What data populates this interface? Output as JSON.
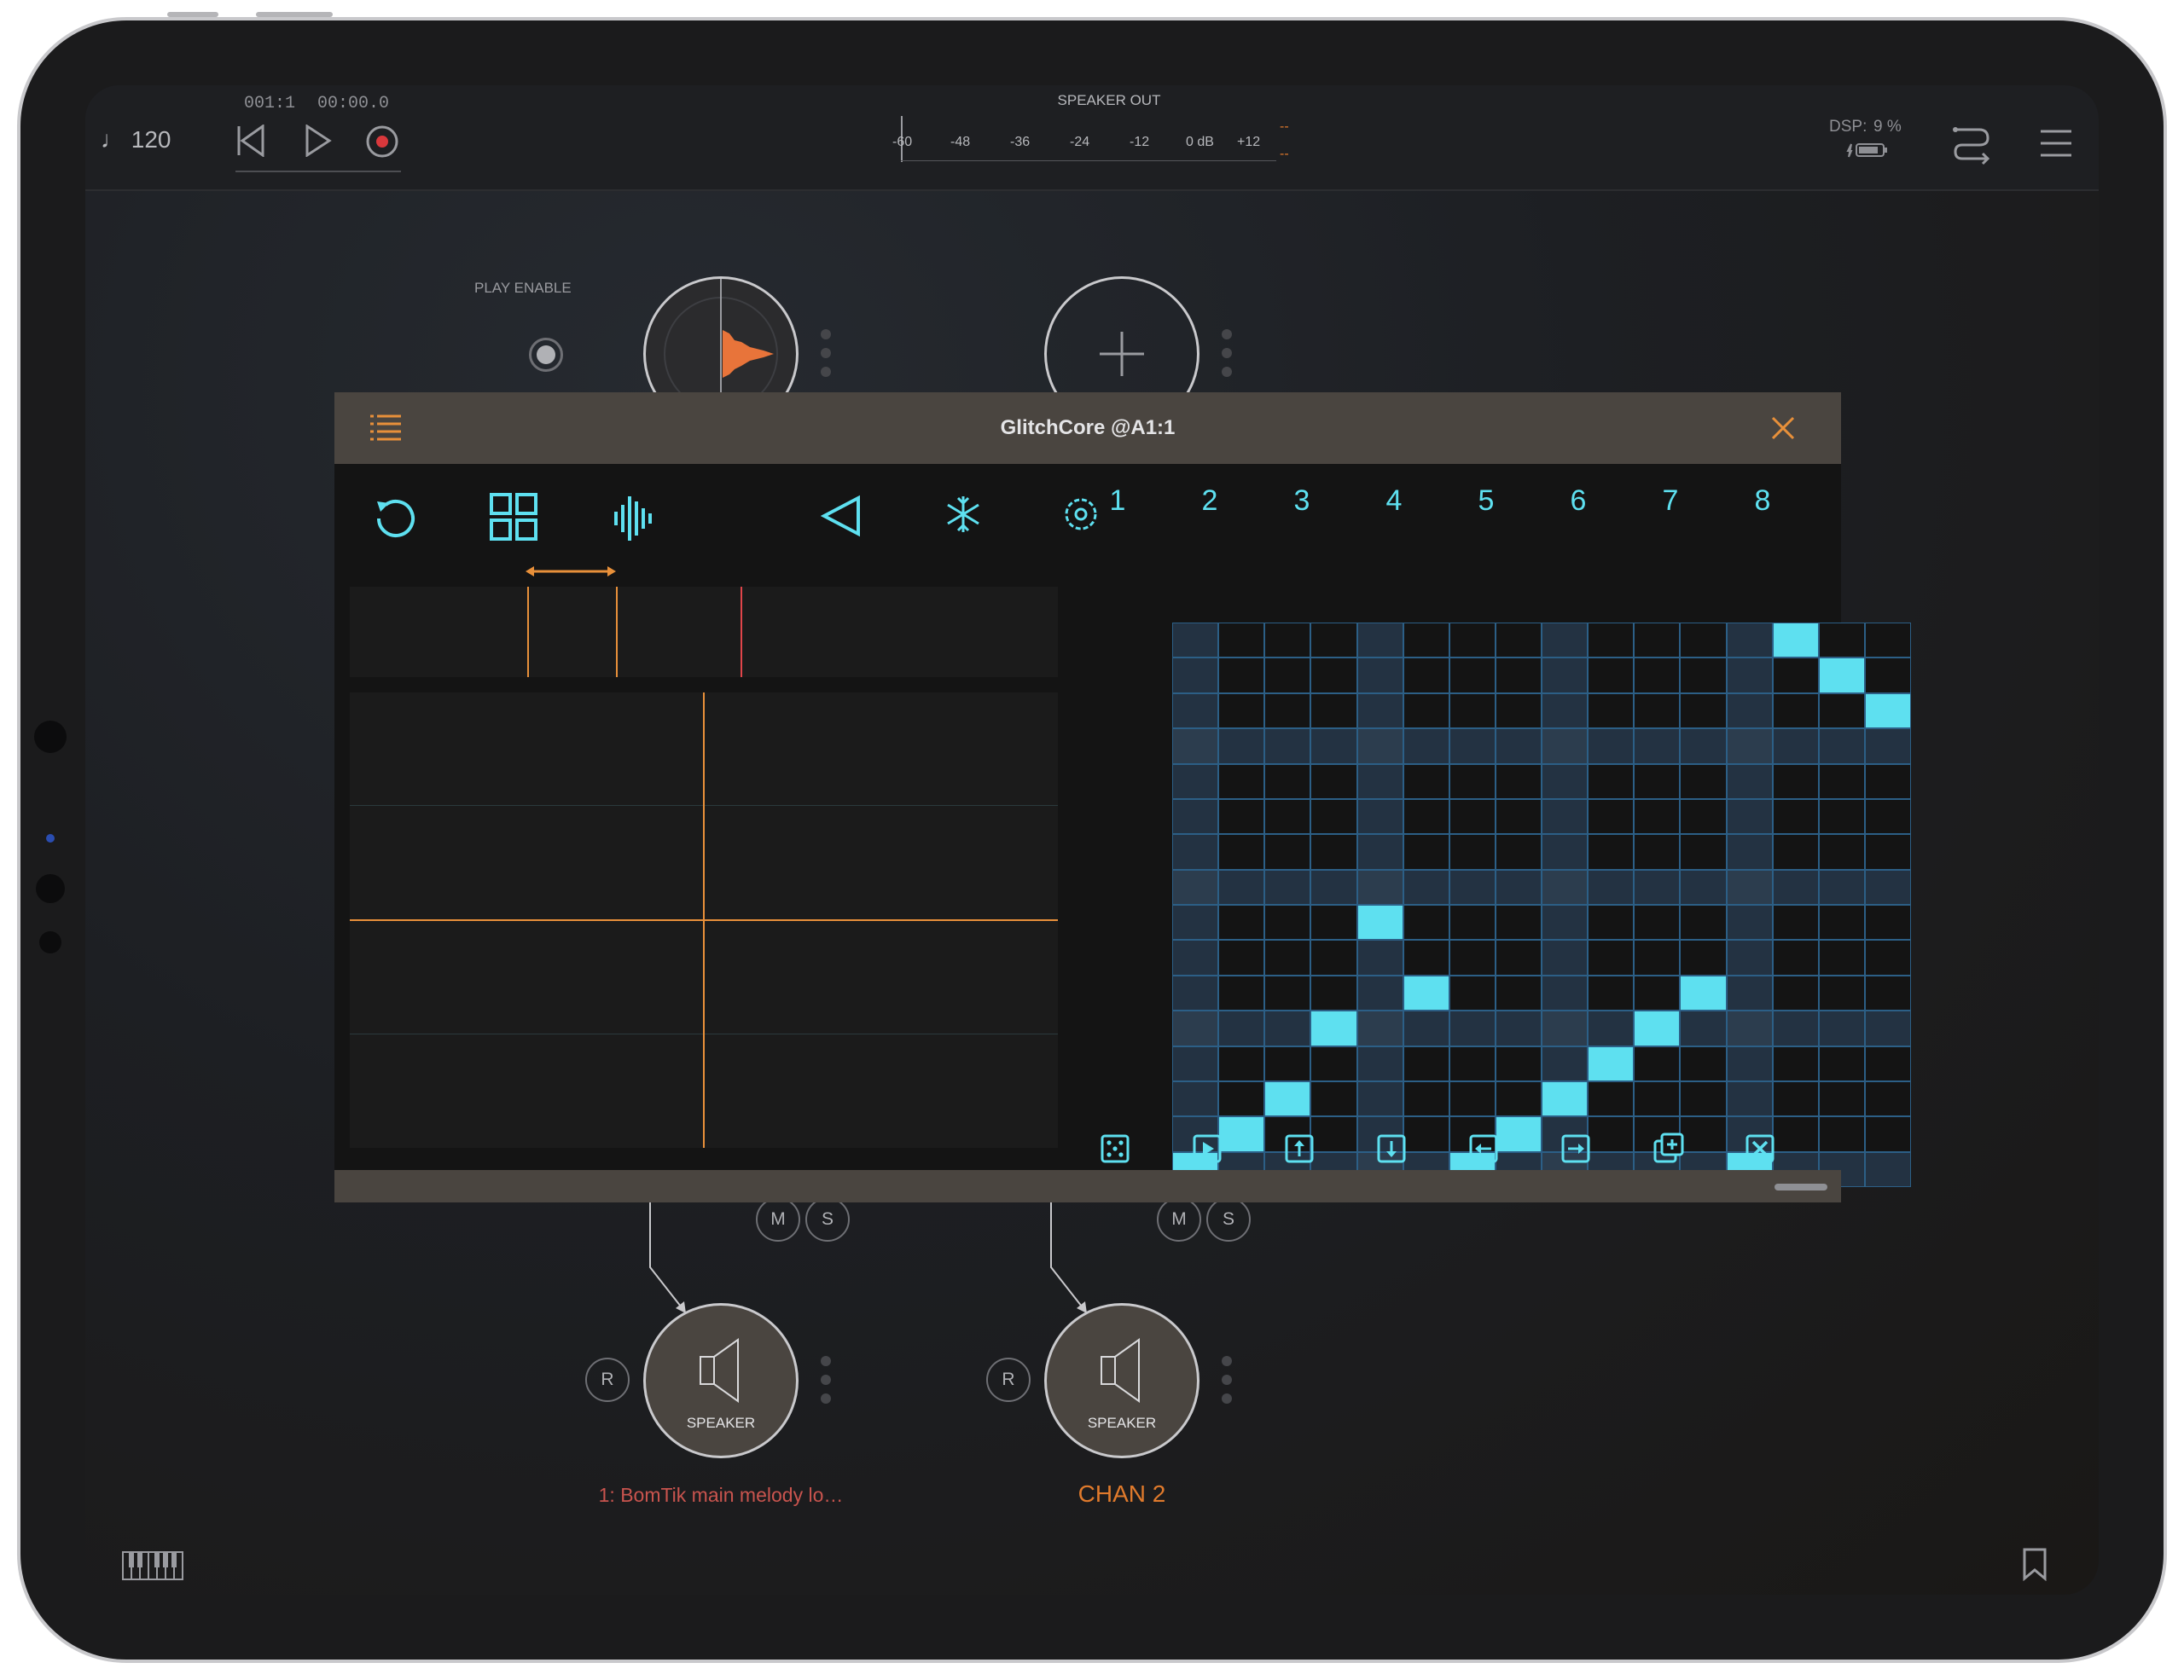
{
  "transport": {
    "tempo": "♩ 120",
    "position": "001:1",
    "time": "00:00.0"
  },
  "meter": {
    "title": "SPEAKER OUT",
    "scale": [
      "-60",
      "-48",
      "-36",
      "-24",
      "-12",
      "0 dB",
      "+12"
    ],
    "peak_marks": [
      "--",
      "--"
    ]
  },
  "status": {
    "dsp_label": "DSP:",
    "dsp_value": "9 %"
  },
  "canvas": {
    "play_enable_label": "PLAY ENABLE",
    "speakers": [
      {
        "label": "SPEAKER",
        "name": "1: BomTik main melody lo…",
        "name_color": "#c9544e"
      },
      {
        "label": "SPEAKER",
        "name": "CHAN 2",
        "name_color": "#e07a2c"
      }
    ],
    "mute_label": "M",
    "solo_label": "S",
    "record_label": "R"
  },
  "plugin": {
    "title": "GlitchCore @A1:1",
    "tabs": [
      "reload-icon",
      "grid-icon",
      "waveform-icon",
      "reverse-icon",
      "freeze-icon",
      "settings-icon"
    ],
    "column_numbers": [
      "1",
      "2",
      "3",
      "4",
      "5",
      "6",
      "7",
      "8"
    ],
    "grid": {
      "columns": 16,
      "rows": 16,
      "active_cells": [
        [
          0,
          15
        ],
        [
          1,
          14
        ],
        [
          2,
          13
        ],
        [
          3,
          11
        ],
        [
          4,
          8
        ],
        [
          5,
          10
        ],
        [
          6,
          15
        ],
        [
          7,
          14
        ],
        [
          8,
          13
        ],
        [
          9,
          12
        ],
        [
          10,
          11
        ],
        [
          11,
          10
        ],
        [
          12,
          15
        ],
        [
          13,
          0
        ],
        [
          14,
          1
        ],
        [
          15,
          2
        ]
      ],
      "cell_color": "#5ee0f0"
    },
    "grid_controls": [
      "randomize-icon",
      "play-icon",
      "shift-up-icon",
      "shift-down-icon",
      "shift-left-icon",
      "shift-right-icon",
      "copy-icon",
      "clear-icon"
    ],
    "accent": "#e8903a",
    "cursor_color": "#e0454a"
  }
}
